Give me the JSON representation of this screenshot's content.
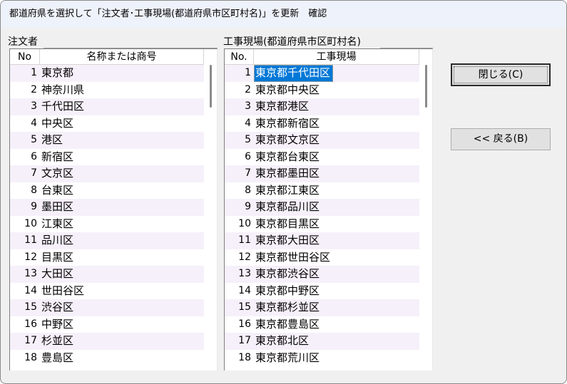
{
  "window": {
    "title": "都道府県を選択して「注文者･工事現場(都道府県市区町村名)」を更新　確認"
  },
  "left_group": {
    "label": "注文者",
    "headers": {
      "no": "No",
      "name": "名称または商号"
    },
    "rows": [
      {
        "no": "1",
        "name": "東京都"
      },
      {
        "no": "2",
        "name": "神奈川県"
      },
      {
        "no": "3",
        "name": "千代田区"
      },
      {
        "no": "4",
        "name": "中央区"
      },
      {
        "no": "5",
        "name": "港区"
      },
      {
        "no": "6",
        "name": "新宿区"
      },
      {
        "no": "7",
        "name": "文京区"
      },
      {
        "no": "8",
        "name": "台東区"
      },
      {
        "no": "9",
        "name": "墨田区"
      },
      {
        "no": "10",
        "name": "江東区"
      },
      {
        "no": "11",
        "name": "品川区"
      },
      {
        "no": "12",
        "name": "目黒区"
      },
      {
        "no": "13",
        "name": "大田区"
      },
      {
        "no": "14",
        "name": "世田谷区"
      },
      {
        "no": "15",
        "name": "渋谷区"
      },
      {
        "no": "16",
        "name": "中野区"
      },
      {
        "no": "17",
        "name": "杉並区"
      },
      {
        "no": "18",
        "name": "豊島区"
      }
    ]
  },
  "right_group": {
    "label": "工事現場(都道府県市区町村名)",
    "headers": {
      "no": "No.",
      "name": "工事現場"
    },
    "selected_index": 0,
    "rows": [
      {
        "no": "1",
        "name": "東京都千代田区"
      },
      {
        "no": "2",
        "name": "東京都中央区"
      },
      {
        "no": "3",
        "name": "東京都港区"
      },
      {
        "no": "4",
        "name": "東京都新宿区"
      },
      {
        "no": "5",
        "name": "東京都文京区"
      },
      {
        "no": "6",
        "name": "東京都台東区"
      },
      {
        "no": "7",
        "name": "東京都墨田区"
      },
      {
        "no": "8",
        "name": "東京都江東区"
      },
      {
        "no": "9",
        "name": "東京都品川区"
      },
      {
        "no": "10",
        "name": "東京都目黒区"
      },
      {
        "no": "11",
        "name": "東京都大田区"
      },
      {
        "no": "12",
        "name": "東京都世田谷区"
      },
      {
        "no": "13",
        "name": "東京都渋谷区"
      },
      {
        "no": "14",
        "name": "東京都中野区"
      },
      {
        "no": "15",
        "name": "東京都杉並区"
      },
      {
        "no": "16",
        "name": "東京都豊島区"
      },
      {
        "no": "17",
        "name": "東京都北区"
      },
      {
        "no": "18",
        "name": "東京都荒川区"
      }
    ]
  },
  "buttons": {
    "close": "閉じる(C)",
    "back": "<< 戻る(B)"
  },
  "colors": {
    "selection": "#0078d7",
    "alt_row": "#f6f0fa",
    "title_bar": "#eef2fa",
    "dialog_bg": "#f0f0f0"
  }
}
